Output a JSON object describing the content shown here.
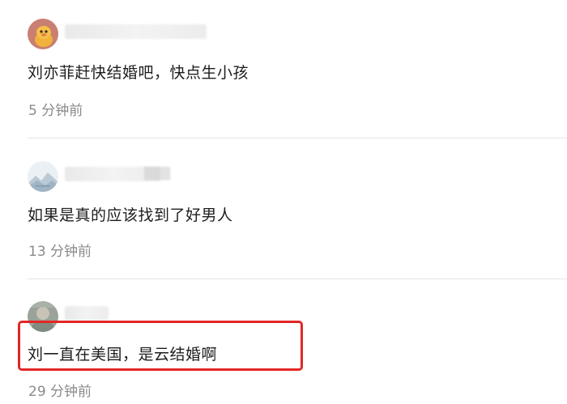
{
  "comments": [
    {
      "text": "刘亦菲赶快结婚吧，快点生小孩",
      "time": "5 分钟前",
      "avatar_icon": "cartoon-animal-avatar-icon"
    },
    {
      "text": "如果是真的应该找到了好男人",
      "time": "13 分钟前",
      "avatar_icon": "landscape-avatar-icon"
    },
    {
      "text": "刘一直在美国，是云结婚啊",
      "time": "29 分钟前",
      "avatar_icon": "photo-avatar-icon"
    }
  ],
  "colors": {
    "highlight": "#e32626",
    "timestamp": "#8a8a8a",
    "divider": "#e6e6e6"
  }
}
